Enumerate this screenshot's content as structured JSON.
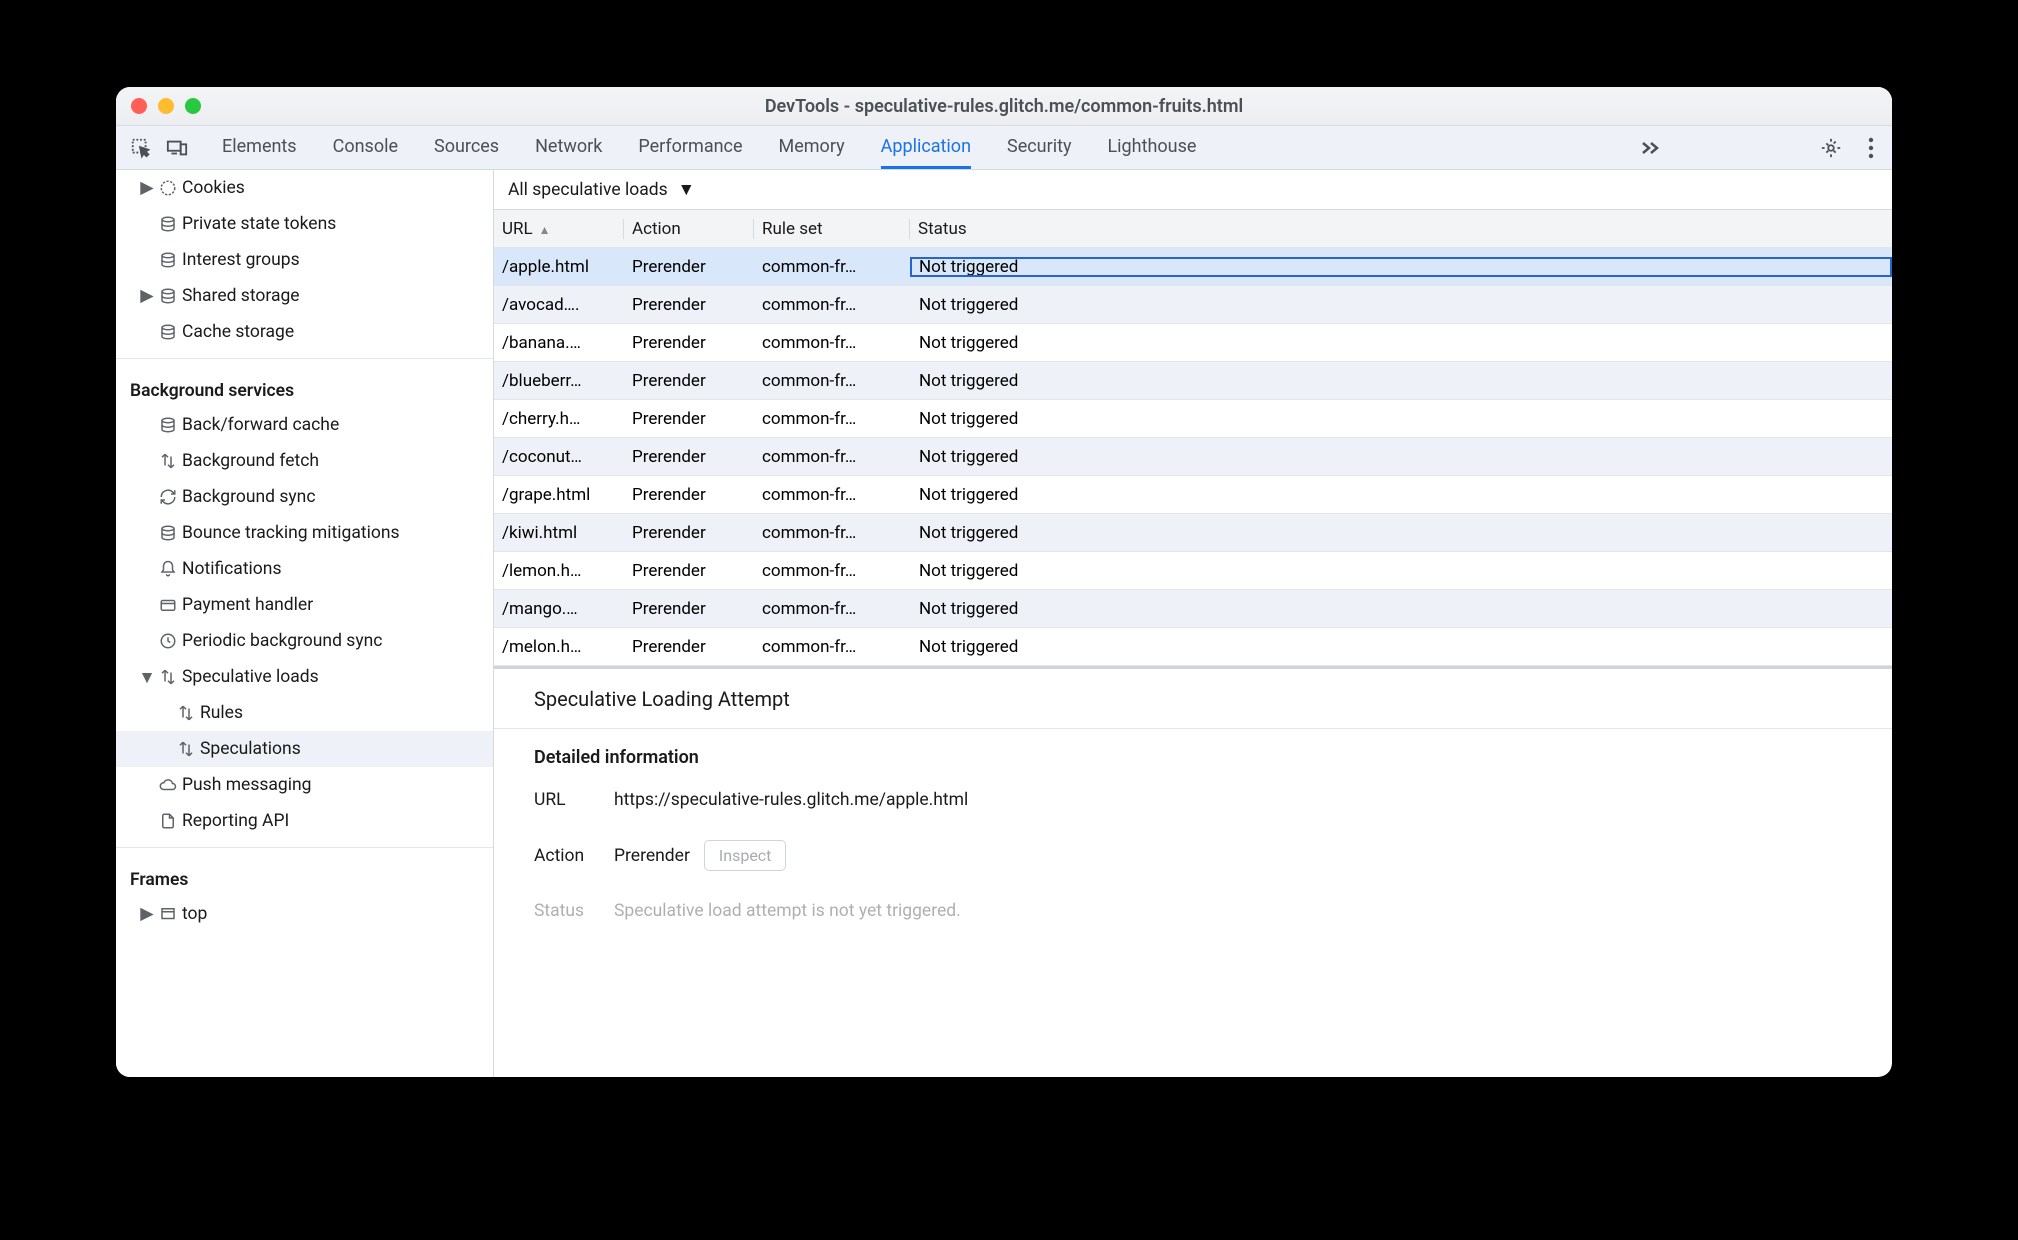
{
  "window_title": "DevTools - speculative-rules.glitch.me/common-fruits.html",
  "toolbar_tabs": [
    "Elements",
    "Console",
    "Sources",
    "Network",
    "Performance",
    "Memory",
    "Application",
    "Security",
    "Lighthouse"
  ],
  "active_tab": "Application",
  "sidebar": {
    "storage": [
      {
        "label": "Cookies",
        "icon": "cookies",
        "expander": true
      },
      {
        "label": "Private state tokens",
        "icon": "db"
      },
      {
        "label": "Interest groups",
        "icon": "db"
      },
      {
        "label": "Shared storage",
        "icon": "db",
        "expander": true
      },
      {
        "label": "Cache storage",
        "icon": "db"
      }
    ],
    "background_header": "Background services",
    "background": [
      {
        "label": "Back/forward cache",
        "icon": "db"
      },
      {
        "label": "Background fetch",
        "icon": "arrows"
      },
      {
        "label": "Background sync",
        "icon": "sync"
      },
      {
        "label": "Bounce tracking mitigations",
        "icon": "db"
      },
      {
        "label": "Notifications",
        "icon": "bell"
      },
      {
        "label": "Payment handler",
        "icon": "card"
      },
      {
        "label": "Periodic background sync",
        "icon": "clock"
      },
      {
        "label": "Speculative loads",
        "icon": "arrows",
        "expander": true,
        "open": true
      },
      {
        "label": "Rules",
        "icon": "arrows",
        "child": true
      },
      {
        "label": "Speculations",
        "icon": "arrows",
        "child": true,
        "selected": true
      },
      {
        "label": "Push messaging",
        "icon": "cloud"
      },
      {
        "label": "Reporting API",
        "icon": "file"
      }
    ],
    "frames_header": "Frames",
    "frames": [
      {
        "label": "top",
        "icon": "frame",
        "expander": true
      }
    ]
  },
  "filter_label": "All speculative loads",
  "columns": {
    "url": "URL",
    "action": "Action",
    "ruleset": "Rule set",
    "status": "Status"
  },
  "rows": [
    {
      "url": "/apple.html",
      "action": "Prerender",
      "ruleset": "common-fr…",
      "status": "Not triggered",
      "selected": true
    },
    {
      "url": "/avocad….",
      "action": "Prerender",
      "ruleset": "common-fr…",
      "status": "Not triggered"
    },
    {
      "url": "/banana.…",
      "action": "Prerender",
      "ruleset": "common-fr…",
      "status": "Not triggered"
    },
    {
      "url": "/blueberr…",
      "action": "Prerender",
      "ruleset": "common-fr…",
      "status": "Not triggered"
    },
    {
      "url": "/cherry.h…",
      "action": "Prerender",
      "ruleset": "common-fr…",
      "status": "Not triggered"
    },
    {
      "url": "/coconut…",
      "action": "Prerender",
      "ruleset": "common-fr…",
      "status": "Not triggered"
    },
    {
      "url": "/grape.html",
      "action": "Prerender",
      "ruleset": "common-fr…",
      "status": "Not triggered"
    },
    {
      "url": "/kiwi.html",
      "action": "Prerender",
      "ruleset": "common-fr…",
      "status": "Not triggered"
    },
    {
      "url": "/lemon.h…",
      "action": "Prerender",
      "ruleset": "common-fr…",
      "status": "Not triggered"
    },
    {
      "url": "/mango.…",
      "action": "Prerender",
      "ruleset": "common-fr…",
      "status": "Not triggered"
    },
    {
      "url": "/melon.h…",
      "action": "Prerender",
      "ruleset": "common-fr…",
      "status": "Not triggered"
    }
  ],
  "detail": {
    "title": "Speculative Loading Attempt",
    "subtitle": "Detailed information",
    "url_label": "URL",
    "url": "https://speculative-rules.glitch.me/apple.html",
    "action_label": "Action",
    "action": "Prerender",
    "inspect": "Inspect",
    "status_label": "Status",
    "status": "Speculative load attempt is not yet triggered."
  }
}
